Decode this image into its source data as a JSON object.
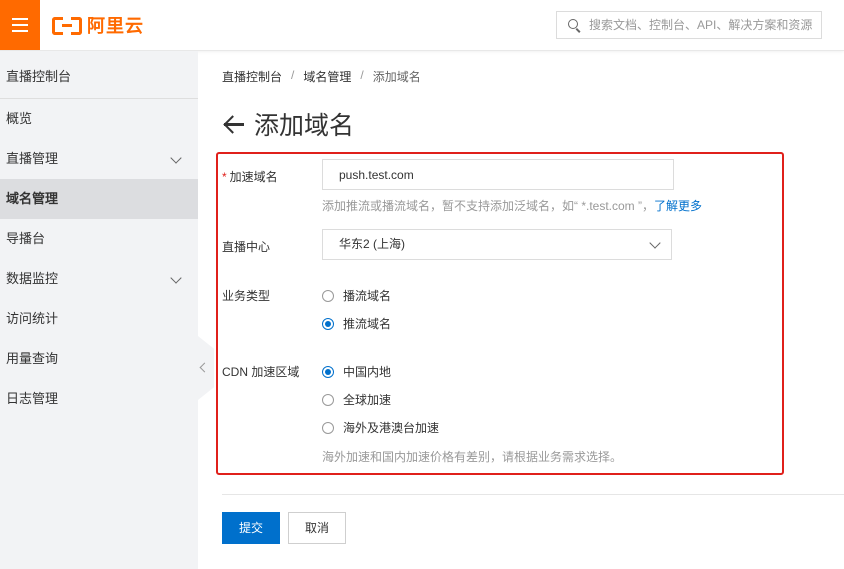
{
  "header": {
    "logo_text": "阿里云",
    "search_placeholder": "搜索文档、控制台、API、解决方案和资源"
  },
  "sidebar": {
    "title": "直播控制台",
    "items": [
      {
        "label": "概览",
        "expandable": false
      },
      {
        "label": "直播管理",
        "expandable": true
      },
      {
        "label": "域名管理",
        "expandable": false,
        "active": true
      },
      {
        "label": "导播台",
        "expandable": false
      },
      {
        "label": "数据监控",
        "expandable": true
      },
      {
        "label": "访问统计",
        "expandable": false
      },
      {
        "label": "用量查询",
        "expandable": false
      },
      {
        "label": "日志管理",
        "expandable": false
      }
    ]
  },
  "breadcrumb": {
    "items": [
      "直播控制台",
      "域名管理",
      "添加域名"
    ],
    "separator": "/"
  },
  "page": {
    "title": "添加域名"
  },
  "form": {
    "domain": {
      "required_mark": "*",
      "label": "加速域名",
      "value": "push.test.com",
      "hint_text": "添加推流或播流域名，暂不支持添加泛域名，如“ *.test.com ”，",
      "hint_link": "了解更多"
    },
    "center": {
      "label": "直播中心",
      "selected": "华东2 (上海)"
    },
    "business_type": {
      "label": "业务类型",
      "options": [
        {
          "label": "播流域名",
          "checked": false
        },
        {
          "label": "推流域名",
          "checked": true
        }
      ]
    },
    "cdn_region": {
      "label": "CDN 加速区域",
      "options": [
        {
          "label": "中国内地",
          "checked": true
        },
        {
          "label": "全球加速",
          "checked": false
        },
        {
          "label": "海外及港澳台加速",
          "checked": false
        }
      ],
      "hint": "海外加速和国内加速价格有差别，请根据业务需求选择。"
    }
  },
  "actions": {
    "submit_label": "提交",
    "cancel_label": "取消"
  },
  "colors": {
    "brand": "#ff6a00",
    "primary": "#0070cc",
    "highlight": "#e0201b"
  }
}
